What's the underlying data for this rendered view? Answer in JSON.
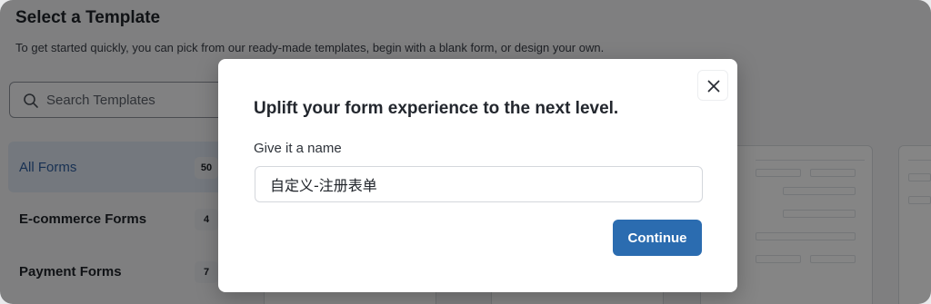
{
  "page": {
    "title": "Select a Template",
    "subtitle": "To get started quickly, you can pick from our ready-made templates, begin with a blank form, or design your own."
  },
  "search": {
    "placeholder": "Search Templates",
    "icon": "search-icon"
  },
  "categories": [
    {
      "label": "All Forms",
      "count": "50",
      "active": true
    },
    {
      "label": "E-commerce Forms",
      "count": "4",
      "active": false
    },
    {
      "label": "Payment Forms",
      "count": "7",
      "active": false
    }
  ],
  "modal": {
    "title": "Uplift your form experience to the next level.",
    "field_label": "Give it a name",
    "name_value": "自定义-注册表单",
    "continue_label": "Continue",
    "close_icon": "close-icon"
  },
  "colors": {
    "primary": "#2b6cb0",
    "overlay": "rgba(0,0,0,0.48)",
    "active_category_bg": "#dfe6f1"
  }
}
